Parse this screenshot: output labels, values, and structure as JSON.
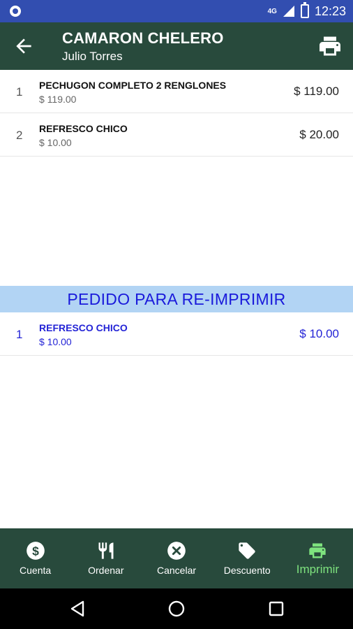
{
  "status_bar": {
    "network": "4G",
    "time": "12:23"
  },
  "toolbar": {
    "title": "CAMARON CHELERO",
    "subtitle": "Julio Torres"
  },
  "items": [
    {
      "qty": "1",
      "name": "PECHUGON COMPLETO 2 RENGLONES",
      "unit_price": "$ 119.00",
      "total": "$ 119.00"
    },
    {
      "qty": "2",
      "name": "REFRESCO CHICO",
      "unit_price": "$ 10.00",
      "total": "$ 20.00"
    }
  ],
  "reprint_section": {
    "header": "PEDIDO PARA RE-IMPRIMIR",
    "items": [
      {
        "qty": "1",
        "name": "REFRESCO CHICO",
        "unit_price": "$ 10.00",
        "total": "$ 10.00"
      }
    ]
  },
  "bottom_nav": {
    "tabs": [
      {
        "label": "Cuenta",
        "icon": "dollar-icon"
      },
      {
        "label": "Ordenar",
        "icon": "fork-knife-icon"
      },
      {
        "label": "Cancelar",
        "icon": "cancel-icon"
      },
      {
        "label": "Descuento",
        "icon": "tag-icon"
      },
      {
        "label": "Imprimir",
        "icon": "print-icon"
      }
    ],
    "active_tab": "Imprimir"
  },
  "colors": {
    "status_bar": "#324eb0",
    "toolbar": "#284a3c",
    "section_header_bg": "#b2d4f4",
    "accent_blue": "#1a1adb",
    "active_tab": "#7ee27e"
  }
}
